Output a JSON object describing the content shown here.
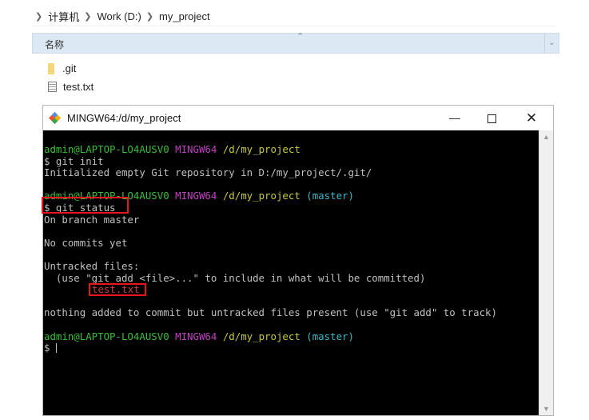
{
  "explorer": {
    "breadcrumb": [
      "计算机",
      "Work (D:)",
      "my_project"
    ],
    "column_header": "名称",
    "files": [
      {
        "name": ".git",
        "icon": "folder-icon"
      },
      {
        "name": "test.txt",
        "icon": "text-file-icon"
      }
    ]
  },
  "terminal": {
    "title": "MINGW64:/d/my_project",
    "controls": {
      "minimize": "—",
      "close": "✕"
    },
    "prompt_user": "admin@LAPTOP-LO4AUSV0",
    "prompt_env": "MINGW64",
    "prompt_path": "/d/my_project",
    "branch": "(master)",
    "commands": {
      "init": "$ git init",
      "status": "$ git status",
      "empty": "$ "
    },
    "output": {
      "init_msg": "Initialized empty Git repository in D:/my_project/.git/",
      "on_branch": "On branch master",
      "no_commits": "No commits yet",
      "untracked_header": "Untracked files:",
      "untracked_hint": "  (use \"git add <file>...\" to include in what will be committed)",
      "untracked_file": "test.txt",
      "nothing_added": "nothing added to commit but untracked files present (use \"git add\" to track)"
    },
    "colors": {
      "background": "#000000",
      "user": "#3cbc3c",
      "env": "#c040c0",
      "path": "#c8c83c",
      "branch": "#3cb8c8",
      "untracked": "#c83c3c",
      "highlight_box": "#e8141e"
    }
  }
}
